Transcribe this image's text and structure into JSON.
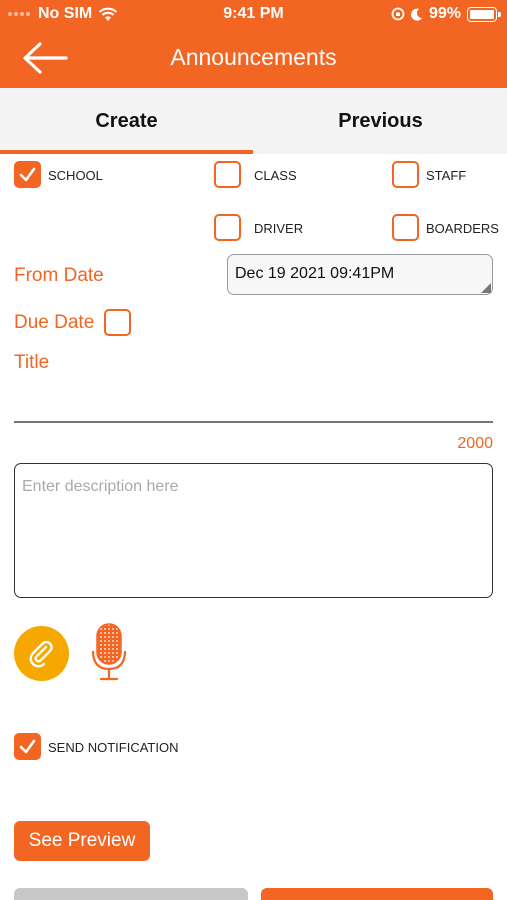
{
  "status_bar": {
    "carrier": "No SIM",
    "time": "9:41 PM",
    "battery": "99%"
  },
  "header": {
    "title": "Announcements"
  },
  "tabs": [
    {
      "label": "Create",
      "active": true
    },
    {
      "label": "Previous",
      "active": false
    }
  ],
  "recipients": {
    "school": {
      "label": "SCHOOL",
      "checked": true
    },
    "class": {
      "label": "CLASS",
      "checked": false
    },
    "staff": {
      "label": "STAFF",
      "checked": false
    },
    "driver": {
      "label": "DRIVER",
      "checked": false
    },
    "boarders": {
      "label": "BOARDERS",
      "checked": false
    }
  },
  "form": {
    "from_date_label": "From Date",
    "from_date_value": "Dec 19 2021 09:41PM",
    "due_date_label": "Due Date",
    "title_label": "Title",
    "char_limit": "2000",
    "description_placeholder": "Enter description here",
    "send_notification_label": "SEND NOTIFICATION"
  },
  "actions": {
    "see_preview": "See Preview"
  },
  "colors": {
    "accent": "#f26522",
    "attach": "#f7a800"
  }
}
